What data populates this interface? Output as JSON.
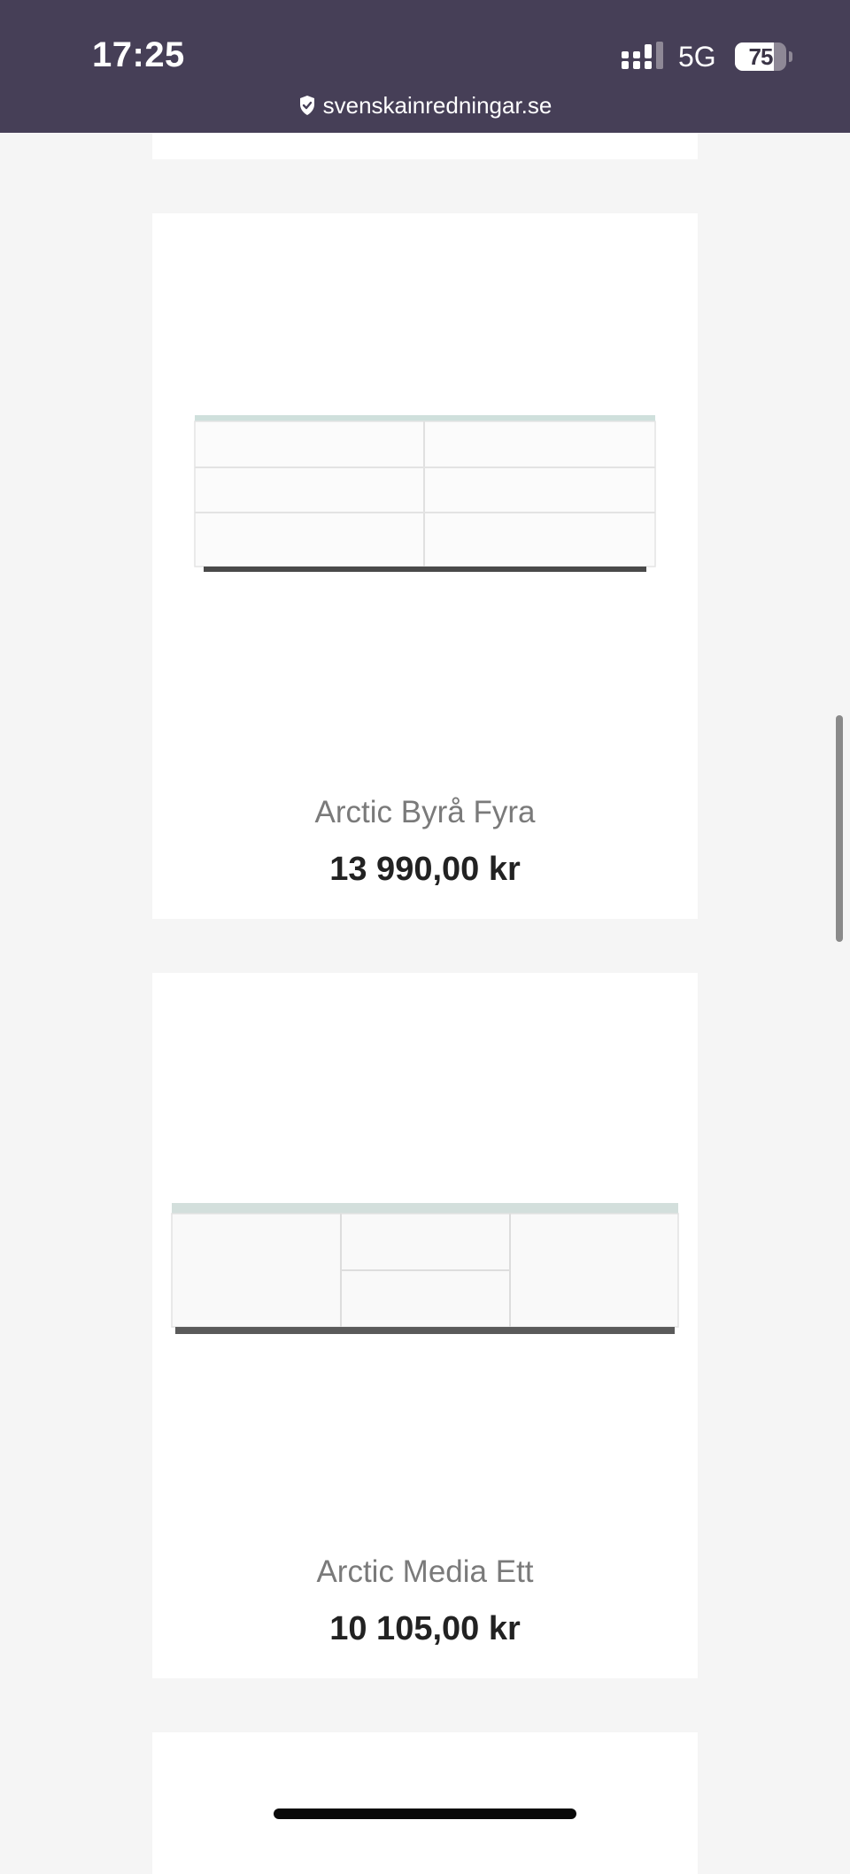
{
  "status_bar": {
    "time": "17:25",
    "network": "5G",
    "battery_level": "75",
    "battery_fraction": 0.75
  },
  "browser": {
    "url": "svenskainredningar.se",
    "secure_icon": "shield-check-icon"
  },
  "products": [
    {
      "name": "Arctic Byrå Fyra",
      "price": "13 990,00 kr",
      "image": "white-chest-of-drawers"
    },
    {
      "name": "Arctic Media Ett",
      "price": "10 105,00 kr",
      "image": "white-media-bench"
    }
  ],
  "colors": {
    "status_bar_bg": "#463f57",
    "page_bg": "#f5f5f5",
    "name_text": "#7a7a7a",
    "price_text": "#222222"
  }
}
